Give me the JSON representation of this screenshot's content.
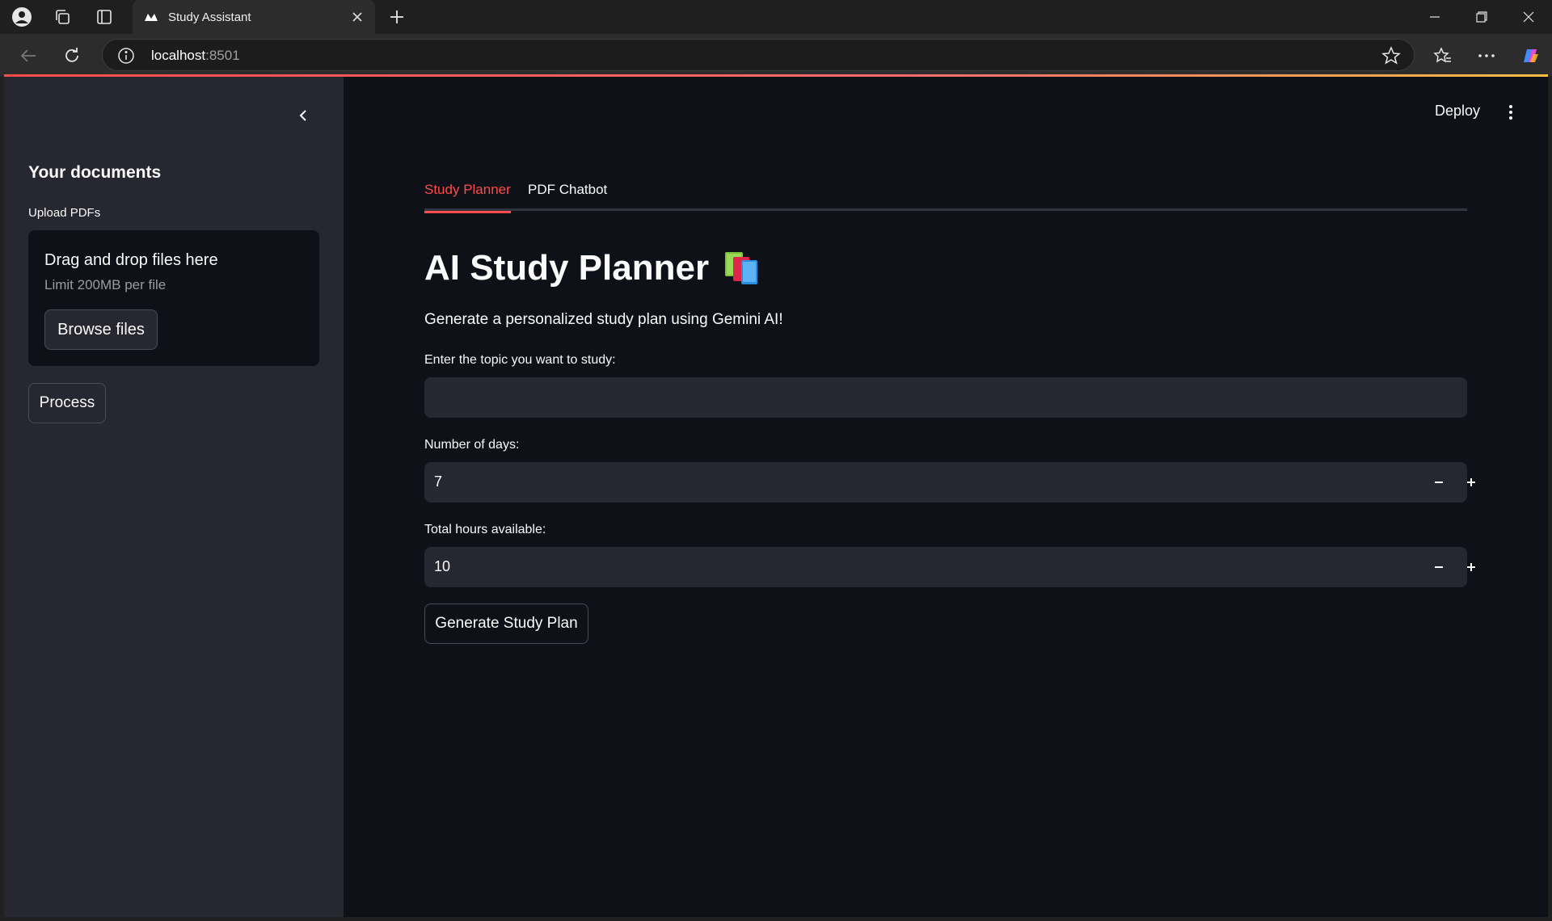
{
  "browser": {
    "tab_title": "Study Assistant",
    "url_host": "localhost",
    "url_port": ":8501"
  },
  "sidebar": {
    "heading": "Your documents",
    "upload_label": "Upload PDFs",
    "dropzone_title": "Drag and drop files here",
    "dropzone_limit": "Limit 200MB per file",
    "browse_label": "Browse files",
    "process_label": "Process"
  },
  "header": {
    "deploy_label": "Deploy"
  },
  "tabs": [
    {
      "label": "Study Planner",
      "active": true
    },
    {
      "label": "PDF Chatbot",
      "active": false
    }
  ],
  "main": {
    "title": "AI Study Planner",
    "title_icon": "books-icon",
    "subtitle": "Generate a personalized study plan using Gemini AI!",
    "topic_label": "Enter the topic you want to study:",
    "topic_value": "",
    "days_label": "Number of days:",
    "days_value": "7",
    "hours_label": "Total hours available:",
    "hours_value": "10",
    "generate_label": "Generate Study Plan"
  },
  "colors": {
    "accent": "#ff4b4b",
    "app_bg": "#0e1117",
    "sidebar_bg": "#262730"
  }
}
